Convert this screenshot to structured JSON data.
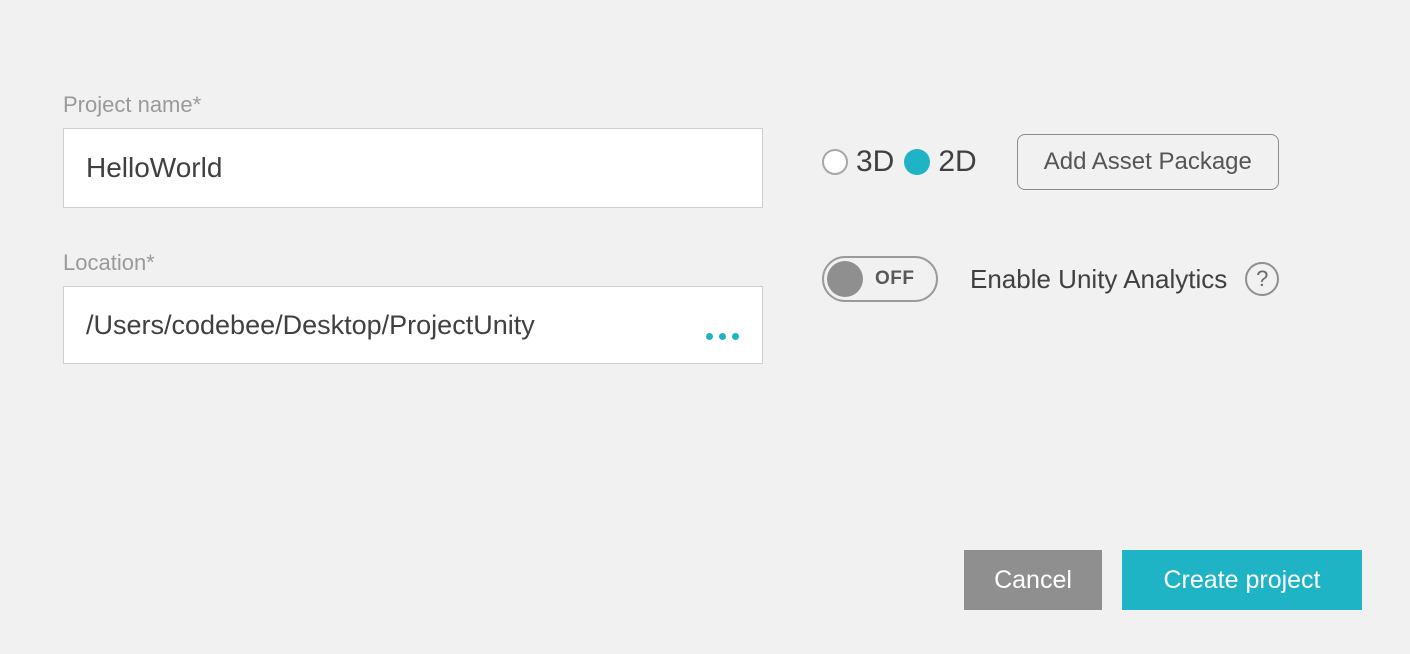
{
  "fields": {
    "project_name_label": "Project name*",
    "project_name_value": "HelloWorld",
    "location_label": "Location*",
    "location_value": "/Users/codebee/Desktop/ProjectUnity"
  },
  "mode": {
    "option_3d": "3D",
    "option_2d": "2D",
    "selected": "2D"
  },
  "buttons": {
    "add_asset": "Add Asset Package",
    "cancel": "Cancel",
    "create": "Create project"
  },
  "analytics": {
    "toggle_state": "OFF",
    "label": "Enable Unity Analytics",
    "help_symbol": "?"
  }
}
